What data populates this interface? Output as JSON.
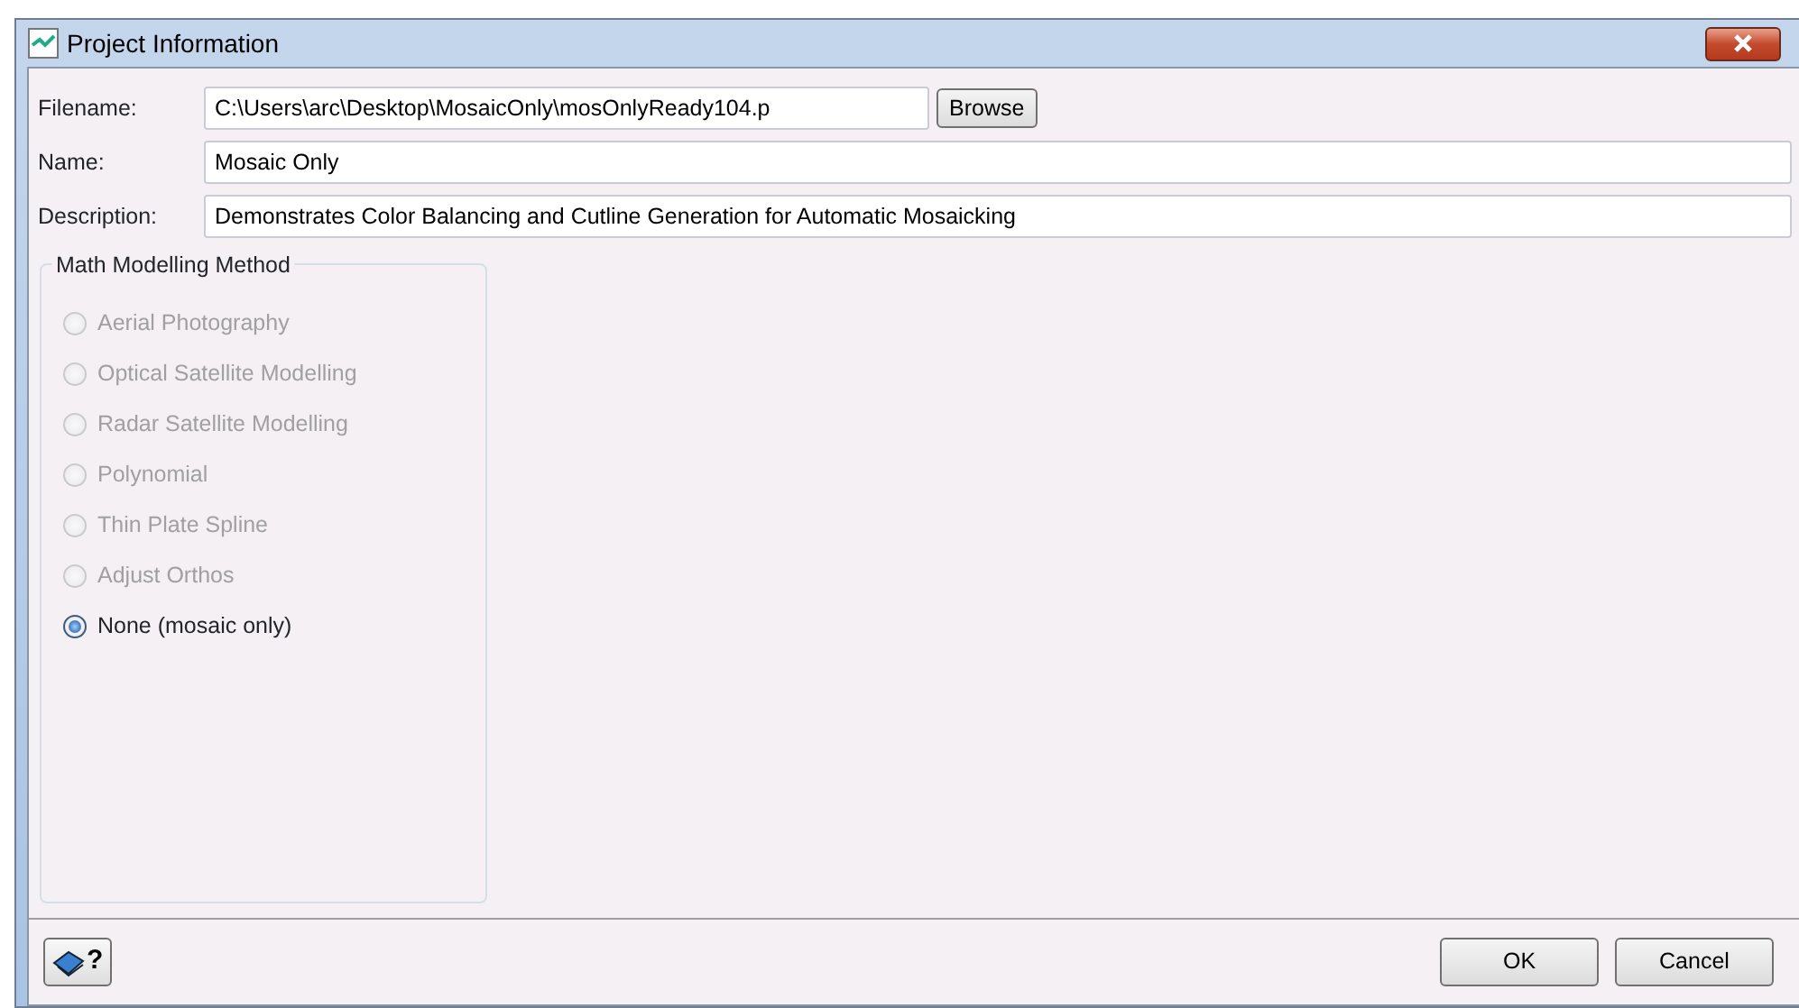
{
  "window": {
    "title": "Project Information"
  },
  "fields": [
    {
      "label": "Filename:",
      "value": "C:\\Users\\arc\\Desktop\\MosaicOnly\\mosOnlyReady104.p",
      "button": "Browse"
    },
    {
      "label": "Name:",
      "value": "Mosaic Only"
    },
    {
      "label": "Description:",
      "value": "Demonstrates Color Balancing and Cutline Generation for Automatic Mosaicking"
    }
  ],
  "group": {
    "title": "Math Modelling Method",
    "options": [
      {
        "label": "Aerial Photography",
        "selected": false,
        "disabled": true
      },
      {
        "label": "Optical Satellite Modelling",
        "selected": false,
        "disabled": true
      },
      {
        "label": "Radar Satellite Modelling",
        "selected": false,
        "disabled": true
      },
      {
        "label": "Polynomial",
        "selected": false,
        "disabled": true
      },
      {
        "label": "Thin Plate Spline",
        "selected": false,
        "disabled": true
      },
      {
        "label": "Adjust Orthos",
        "selected": false,
        "disabled": true
      },
      {
        "label": "None (mosaic only)",
        "selected": true,
        "disabled": false
      }
    ]
  },
  "help_button": {
    "label": "?"
  },
  "buttons": [
    "OK",
    "Cancel"
  ]
}
